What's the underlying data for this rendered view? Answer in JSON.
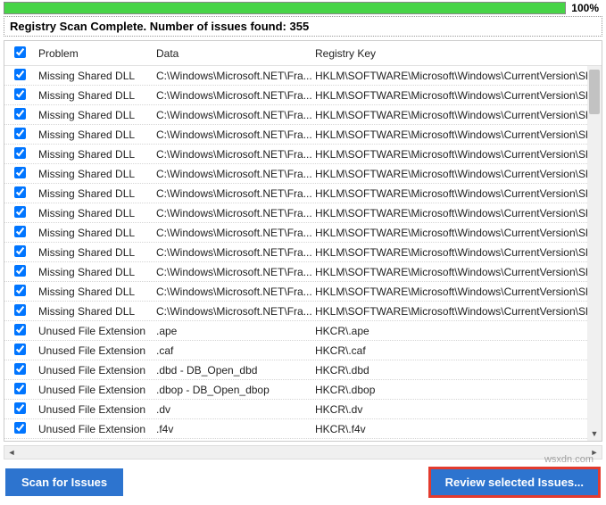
{
  "progress": {
    "percent_label": "100%"
  },
  "status_text": "Registry Scan Complete. Number of issues found: 355",
  "columns": {
    "problem": "Problem",
    "data": "Data",
    "regkey": "Registry Key"
  },
  "select_all_checked": true,
  "rows": [
    {
      "checked": true,
      "problem": "Missing Shared DLL",
      "data": "C:\\Windows\\Microsoft.NET\\Fra...",
      "regkey": "HKLM\\SOFTWARE\\Microsoft\\Windows\\CurrentVersion\\SharedDLLs"
    },
    {
      "checked": true,
      "problem": "Missing Shared DLL",
      "data": "C:\\Windows\\Microsoft.NET\\Fra...",
      "regkey": "HKLM\\SOFTWARE\\Microsoft\\Windows\\CurrentVersion\\SharedDLLs"
    },
    {
      "checked": true,
      "problem": "Missing Shared DLL",
      "data": "C:\\Windows\\Microsoft.NET\\Fra...",
      "regkey": "HKLM\\SOFTWARE\\Microsoft\\Windows\\CurrentVersion\\SharedDLLs"
    },
    {
      "checked": true,
      "problem": "Missing Shared DLL",
      "data": "C:\\Windows\\Microsoft.NET\\Fra...",
      "regkey": "HKLM\\SOFTWARE\\Microsoft\\Windows\\CurrentVersion\\SharedDLLs"
    },
    {
      "checked": true,
      "problem": "Missing Shared DLL",
      "data": "C:\\Windows\\Microsoft.NET\\Fra...",
      "regkey": "HKLM\\SOFTWARE\\Microsoft\\Windows\\CurrentVersion\\SharedDLLs"
    },
    {
      "checked": true,
      "problem": "Missing Shared DLL",
      "data": "C:\\Windows\\Microsoft.NET\\Fra...",
      "regkey": "HKLM\\SOFTWARE\\Microsoft\\Windows\\CurrentVersion\\SharedDLLs"
    },
    {
      "checked": true,
      "problem": "Missing Shared DLL",
      "data": "C:\\Windows\\Microsoft.NET\\Fra...",
      "regkey": "HKLM\\SOFTWARE\\Microsoft\\Windows\\CurrentVersion\\SharedDLLs"
    },
    {
      "checked": true,
      "problem": "Missing Shared DLL",
      "data": "C:\\Windows\\Microsoft.NET\\Fra...",
      "regkey": "HKLM\\SOFTWARE\\Microsoft\\Windows\\CurrentVersion\\SharedDLLs"
    },
    {
      "checked": true,
      "problem": "Missing Shared DLL",
      "data": "C:\\Windows\\Microsoft.NET\\Fra...",
      "regkey": "HKLM\\SOFTWARE\\Microsoft\\Windows\\CurrentVersion\\SharedDLLs"
    },
    {
      "checked": true,
      "problem": "Missing Shared DLL",
      "data": "C:\\Windows\\Microsoft.NET\\Fra...",
      "regkey": "HKLM\\SOFTWARE\\Microsoft\\Windows\\CurrentVersion\\SharedDLLs"
    },
    {
      "checked": true,
      "problem": "Missing Shared DLL",
      "data": "C:\\Windows\\Microsoft.NET\\Fra...",
      "regkey": "HKLM\\SOFTWARE\\Microsoft\\Windows\\CurrentVersion\\SharedDLLs"
    },
    {
      "checked": true,
      "problem": "Missing Shared DLL",
      "data": "C:\\Windows\\Microsoft.NET\\Fra...",
      "regkey": "HKLM\\SOFTWARE\\Microsoft\\Windows\\CurrentVersion\\SharedDLLs"
    },
    {
      "checked": true,
      "problem": "Missing Shared DLL",
      "data": "C:\\Windows\\Microsoft.NET\\Fra...",
      "regkey": "HKLM\\SOFTWARE\\Microsoft\\Windows\\CurrentVersion\\SharedDLLs"
    },
    {
      "checked": true,
      "problem": "Unused File Extension",
      "data": ".ape",
      "regkey": "HKCR\\.ape"
    },
    {
      "checked": true,
      "problem": "Unused File Extension",
      "data": ".caf",
      "regkey": "HKCR\\.caf"
    },
    {
      "checked": true,
      "problem": "Unused File Extension",
      "data": ".dbd - DB_Open_dbd",
      "regkey": "HKCR\\.dbd"
    },
    {
      "checked": true,
      "problem": "Unused File Extension",
      "data": ".dbop - DB_Open_dbop",
      "regkey": "HKCR\\.dbop"
    },
    {
      "checked": true,
      "problem": "Unused File Extension",
      "data": ".dv",
      "regkey": "HKCR\\.dv"
    },
    {
      "checked": true,
      "problem": "Unused File Extension",
      "data": ".f4v",
      "regkey": "HKCR\\.f4v"
    }
  ],
  "buttons": {
    "scan": "Scan for Issues",
    "review": "Review selected Issues..."
  },
  "watermark": "wsxdn.com"
}
